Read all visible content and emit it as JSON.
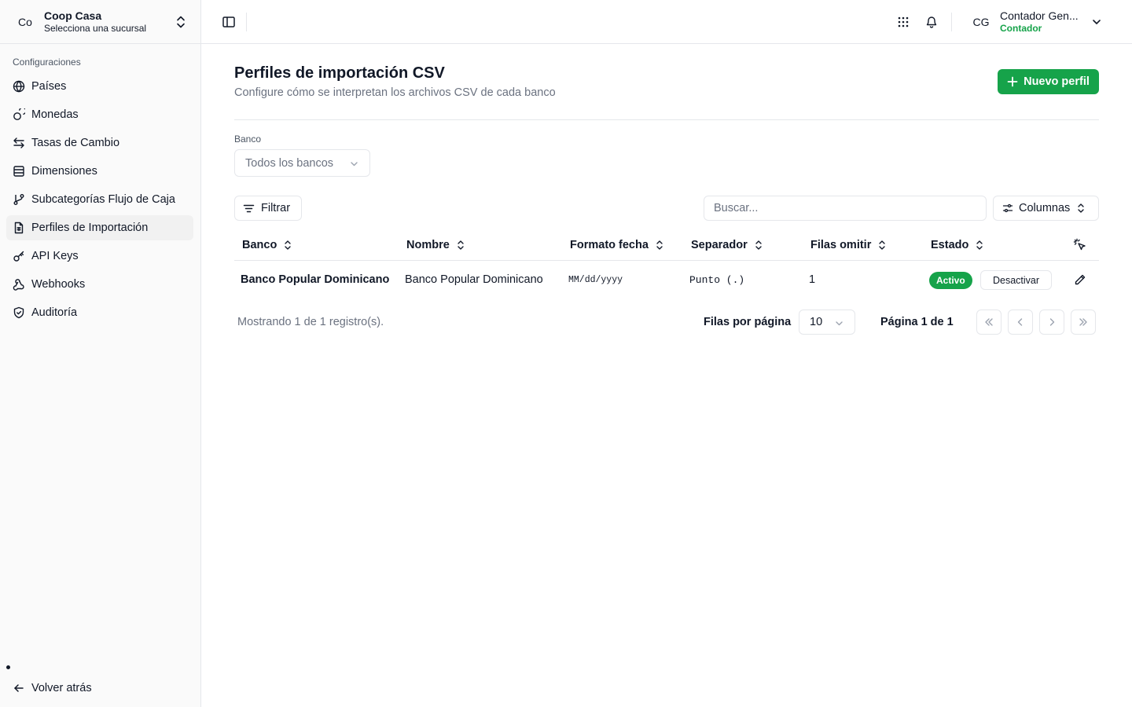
{
  "org": {
    "avatar": "Co",
    "name": "Coop Casa",
    "subtitle": "Selecciona una sucursal"
  },
  "sidebar": {
    "group_label": "Configuraciones",
    "items": [
      {
        "label": "Países",
        "icon": "globe-icon"
      },
      {
        "label": "Monedas",
        "icon": "coins-icon"
      },
      {
        "label": "Tasas de Cambio",
        "icon": "exchange-icon"
      },
      {
        "label": "Dimensiones",
        "icon": "table-icon"
      },
      {
        "label": "Subcategorías Flujo de Caja",
        "icon": "git-branch-icon"
      },
      {
        "label": "Perfiles de Importación",
        "icon": "file-spreadsheet-icon",
        "active": true
      },
      {
        "label": "API Keys",
        "icon": "key-icon"
      },
      {
        "label": "Webhooks",
        "icon": "webhook-icon"
      },
      {
        "label": "Auditoría",
        "icon": "shield-icon"
      }
    ],
    "back_label": "Volver atrás"
  },
  "user": {
    "initials": "CG",
    "name": "Contador Gen...",
    "role": "Contador"
  },
  "page": {
    "title": "Perfiles de importación CSV",
    "subtitle": "Configure cómo se interpretan los archivos CSV de cada banco",
    "new_button": "Nuevo perfil"
  },
  "filters": {
    "bank_label": "Banco",
    "bank_value": "Todos los bancos",
    "filter_button": "Filtrar",
    "search_placeholder": "Buscar...",
    "columns_button": "Columnas"
  },
  "table": {
    "headers": [
      "Banco",
      "Nombre",
      "Formato fecha",
      "Separador",
      "Filas omitir",
      "Estado"
    ],
    "rows": [
      {
        "banco": "Banco Popular Dominicano",
        "nombre": "Banco Popular Dominicano",
        "formato_fecha": "MM/dd/yyyy",
        "separador": "Punto (.)",
        "filas_omitir": "1",
        "estado": "Activo",
        "action": "Desactivar"
      }
    ]
  },
  "pagination": {
    "summary": "Mostrando 1 de 1 registro(s).",
    "rows_per_page_label": "Filas por página",
    "rows_per_page": "10",
    "page_info": "Página 1 de 1"
  },
  "colors": {
    "accent": "#16a34a",
    "border": "#e5e7eb",
    "muted": "#6b7280"
  }
}
